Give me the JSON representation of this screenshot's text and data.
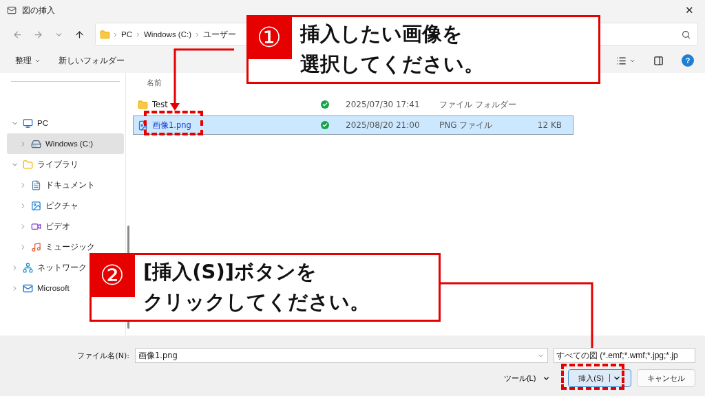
{
  "window": {
    "title": "図の挿入",
    "close": "✕"
  },
  "breadcrumb": [
    "PC",
    "Windows (C:)",
    "ユーザー"
  ],
  "toolbar": {
    "organize": "整理",
    "new_folder": "新しいフォルダー",
    "help": "?"
  },
  "sidebar": {
    "items": [
      {
        "label": "PC",
        "kind": "pc",
        "expanded": true,
        "selected": false,
        "children": [
          {
            "label": "Windows (C:)",
            "kind": "drive",
            "expanded": false,
            "selected": true
          }
        ]
      },
      {
        "label": "ライブラリ",
        "kind": "folder",
        "expanded": true,
        "selected": false,
        "children": [
          {
            "label": "ドキュメント",
            "kind": "documents",
            "expanded": false,
            "selected": false
          },
          {
            "label": "ピクチャ",
            "kind": "pictures",
            "expanded": false,
            "selected": false
          },
          {
            "label": "ビデオ",
            "kind": "videos",
            "expanded": false,
            "selected": false
          },
          {
            "label": "ミュージック",
            "kind": "music",
            "expanded": false,
            "selected": false
          }
        ]
      },
      {
        "label": "ネットワーク",
        "kind": "network",
        "expanded": false,
        "selected": false
      },
      {
        "label": "Microsoft",
        "kind": "outlook",
        "expanded": false,
        "selected": false
      }
    ]
  },
  "table": {
    "columns": [
      "名前"
    ],
    "rows": [
      {
        "name": "Test",
        "kind": "folder",
        "synced": true,
        "date": "2025/07/30 17:41",
        "type": "ファイル フォルダー",
        "size": "",
        "selected": false
      },
      {
        "name": "画像1.png",
        "kind": "image",
        "synced": true,
        "date": "2025/08/20 21:00",
        "type": "PNG ファイル",
        "size": "12 KB",
        "selected": true
      }
    ]
  },
  "footer": {
    "filename_label": "ファイル名(N):",
    "filename": "画像1.png",
    "filter": "すべての図 (*.emf;*.wmf;*.jpg;*.jp",
    "tools": "ツール(L)",
    "insert": "挿入(S)",
    "cancel": "キャンセル"
  },
  "callouts": [
    {
      "number": "①",
      "lines": [
        "挿入したい画像を",
        "選択してください。"
      ]
    },
    {
      "number": "②",
      "lines": [
        "[挿入(S)]ボタンを",
        "クリックしてください。"
      ]
    }
  ]
}
